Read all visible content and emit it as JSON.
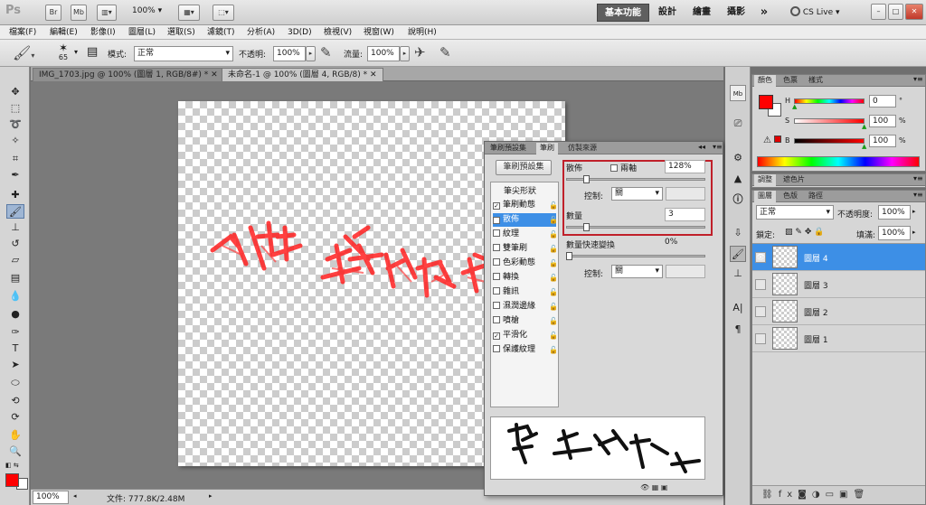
{
  "app": {
    "logo": "Ps",
    "zoom": "100%",
    "workspace_active": "基本功能",
    "workspaces": [
      "設計",
      "繪畫",
      "攝影"
    ],
    "more": "»",
    "cslive": "CS Live",
    "window_buttons": [
      "–",
      "□",
      "✕"
    ],
    "launch_bridge": "Br",
    "launch_minibridge": "Mb"
  },
  "menu": [
    "檔案(F)",
    "編輯(E)",
    "影像(I)",
    "圖層(L)",
    "選取(S)",
    "濾鏡(T)",
    "分析(A)",
    "3D(D)",
    "檢視(V)",
    "視窗(W)",
    "說明(H)"
  ],
  "options": {
    "brush_size": "65",
    "mode_label": "模式:",
    "mode_value": "正常",
    "opacity_label": "不透明:",
    "opacity_value": "100%",
    "flow_label": "流量:",
    "flow_value": "100%"
  },
  "doc_tabs": [
    "IMG_1703.jpg @ 100% (圖層 1, RGB/8#) *",
    "未命名-1 @ 100% (圖層 4, RGB/8) *"
  ],
  "status": {
    "zoom": "100%",
    "file": "文件: 777.8K/2.48M"
  },
  "brush_panel": {
    "tabs": [
      "筆刷預設集",
      "筆刷",
      "仿製來源"
    ],
    "preset_button": "筆刷預設集",
    "list_header": "筆尖形狀",
    "items": [
      {
        "label": "筆刷動態",
        "checked": true
      },
      {
        "label": "散佈",
        "checked": true
      },
      {
        "label": "紋理",
        "checked": false
      },
      {
        "label": "雙筆刷",
        "checked": false
      },
      {
        "label": "色彩動態",
        "checked": false
      },
      {
        "label": "轉換",
        "checked": false
      },
      {
        "label": "雜訊",
        "checked": false
      },
      {
        "label": "濕潤邊緣",
        "checked": false
      },
      {
        "label": "噴槍",
        "checked": false
      },
      {
        "label": "平滑化",
        "checked": true
      },
      {
        "label": "保護紋理",
        "checked": false
      }
    ],
    "scatter_label": "散佈",
    "both_axes_label": "兩軸",
    "scatter_value": "128%",
    "scatter_fraction": 0.13,
    "control_label": "控制:",
    "control_value": "關",
    "count_label": "數量",
    "count_value": "3",
    "count_fraction": 0.13,
    "jitter_label": "數量快速變換",
    "jitter_value": "0%",
    "jitter_fraction": 0
  },
  "color_panel": {
    "tabs": [
      "顏色",
      "色票",
      "樣式"
    ],
    "h_label": "H",
    "h_value": "0",
    "h_unit": "°",
    "s_label": "S",
    "s_value": "100",
    "s_unit": "%",
    "b_label": "B",
    "b_value": "100",
    "b_unit": "%",
    "fg_color": "#ff0000",
    "bg_color": "#ffffff"
  },
  "adj_panel": {
    "tabs": [
      "調整",
      "遮色片"
    ]
  },
  "layers_panel": {
    "tabs": [
      "圖層",
      "色版",
      "路徑"
    ],
    "blend_mode": "正常",
    "opacity_label": "不透明度:",
    "opacity_value": "100%",
    "lock_label": "鎖定:",
    "fill_label": "填滿:",
    "fill_value": "100%",
    "layers": [
      {
        "name": "圖層 4",
        "selected": true,
        "visible": true
      },
      {
        "name": "圖層 3",
        "selected": false,
        "visible": false
      },
      {
        "name": "圖層 2",
        "selected": false,
        "visible": false
      },
      {
        "name": "圖層 1",
        "selected": false,
        "visible": false
      }
    ]
  }
}
